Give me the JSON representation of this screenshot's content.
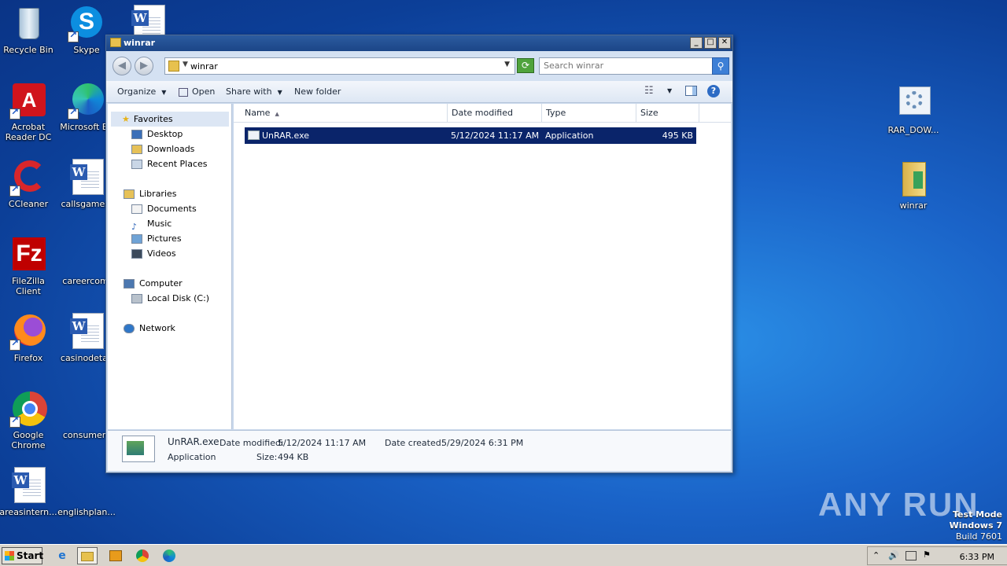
{
  "desktop": {
    "icons": [
      {
        "label": "Recycle Bin"
      },
      {
        "label": "Skype"
      },
      {
        "label": "Acrobat Reader DC"
      },
      {
        "label": "Microsoft Ed"
      },
      {
        "label": "CCleaner"
      },
      {
        "label": "callsgames."
      },
      {
        "label": "FileZilla Client"
      },
      {
        "label": "careercomi"
      },
      {
        "label": "Firefox"
      },
      {
        "label": "casinodetail"
      },
      {
        "label": "Google Chrome"
      },
      {
        "label": "consumerc"
      },
      {
        "label": "areasintern..."
      },
      {
        "label": "englishplan..."
      },
      {
        "label": "RAR_DOW..."
      },
      {
        "label": "winrar"
      }
    ]
  },
  "window": {
    "title": "winrar",
    "address": {
      "crumb": "winrar"
    },
    "search": {
      "placeholder": "Search winrar"
    },
    "toolbar": {
      "organize": "Organize",
      "open": "Open",
      "share_with": "Share with",
      "new_folder": "New folder"
    },
    "nav": {
      "favorites": "Favorites",
      "desktop": "Desktop",
      "downloads": "Downloads",
      "recent": "Recent Places",
      "libraries": "Libraries",
      "documents": "Documents",
      "music": "Music",
      "pictures": "Pictures",
      "videos": "Videos",
      "computer": "Computer",
      "local_disk": "Local Disk (C:)",
      "network": "Network"
    },
    "columns": {
      "name": "Name",
      "date": "Date modified",
      "type": "Type",
      "size": "Size"
    },
    "files": [
      {
        "name": "UnRAR.exe",
        "date": "5/12/2024 11:17 AM",
        "type": "Application",
        "size": "495 KB"
      }
    ],
    "details": {
      "name": "UnRAR.exe",
      "type": "Application",
      "modified_label": "Date modified:",
      "modified": "5/12/2024 11:17 AM",
      "created_label": "Date created:",
      "created": "5/29/2024 6:31 PM",
      "size_label": "Size:",
      "size": "494 KB"
    }
  },
  "taskbar": {
    "start": "Start",
    "clock": "6:33 PM"
  },
  "watermark": "ANY RUN",
  "testmode": {
    "line1": "Test Mode",
    "line2": "Windows 7",
    "line3": "Build 7601"
  }
}
